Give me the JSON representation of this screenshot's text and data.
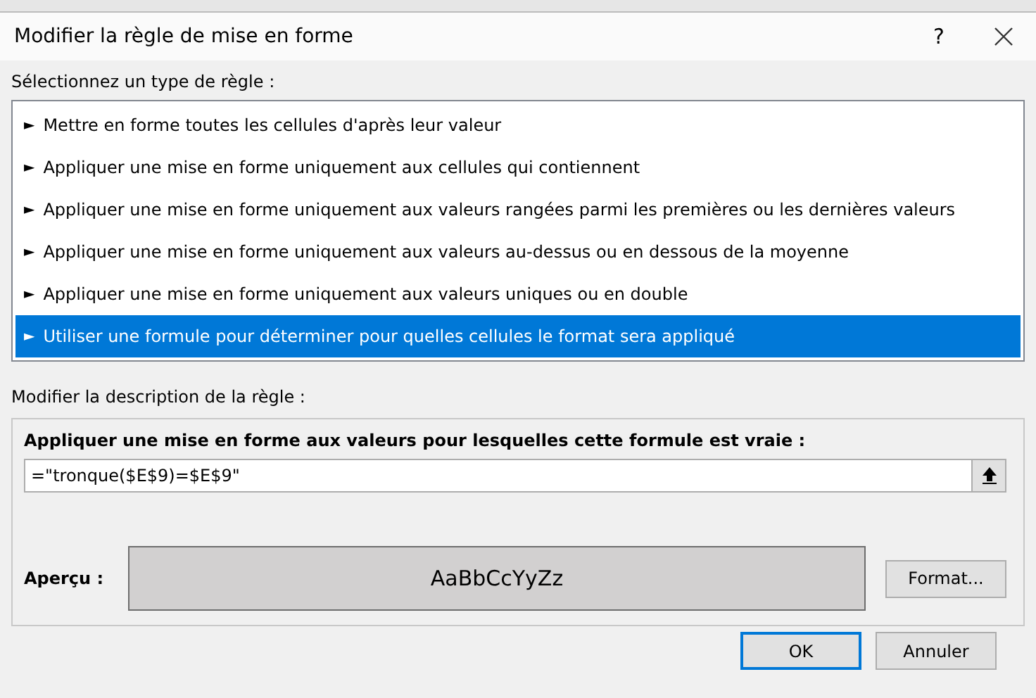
{
  "window": {
    "title": "Modifier la règle de mise en forme",
    "help": "?"
  },
  "rule_types": {
    "label": "Sélectionnez un type de règle :",
    "items": [
      {
        "marker": "►",
        "label": "Mettre en forme toutes les cellules d'après leur valeur",
        "selected": false
      },
      {
        "marker": "►",
        "label": "Appliquer une mise en forme uniquement aux cellules qui contiennent",
        "selected": false
      },
      {
        "marker": "►",
        "label": "Appliquer une mise en forme uniquement aux valeurs rangées parmi les premières ou les dernières valeurs",
        "selected": false
      },
      {
        "marker": "►",
        "label": "Appliquer une mise en forme uniquement aux valeurs au-dessus ou en dessous de la moyenne",
        "selected": false
      },
      {
        "marker": "►",
        "label": "Appliquer une mise en forme uniquement aux valeurs uniques ou en double",
        "selected": false
      },
      {
        "marker": "►",
        "label": "Utiliser une formule pour déterminer pour quelles cellules le format sera appliqué",
        "selected": true
      }
    ]
  },
  "description": {
    "label": "Modifier la description de la règle :",
    "formula_label": "Appliquer une mise en forme aux valeurs pour lesquelles cette formule est vraie :",
    "formula": "=\"tronque($E$9)=$E$9\"",
    "preview_label": "Aperçu :",
    "preview_text": "AaBbCcYyZz",
    "format_button": "Format..."
  },
  "buttons": [
    "OK",
    "Annuler"
  ]
}
